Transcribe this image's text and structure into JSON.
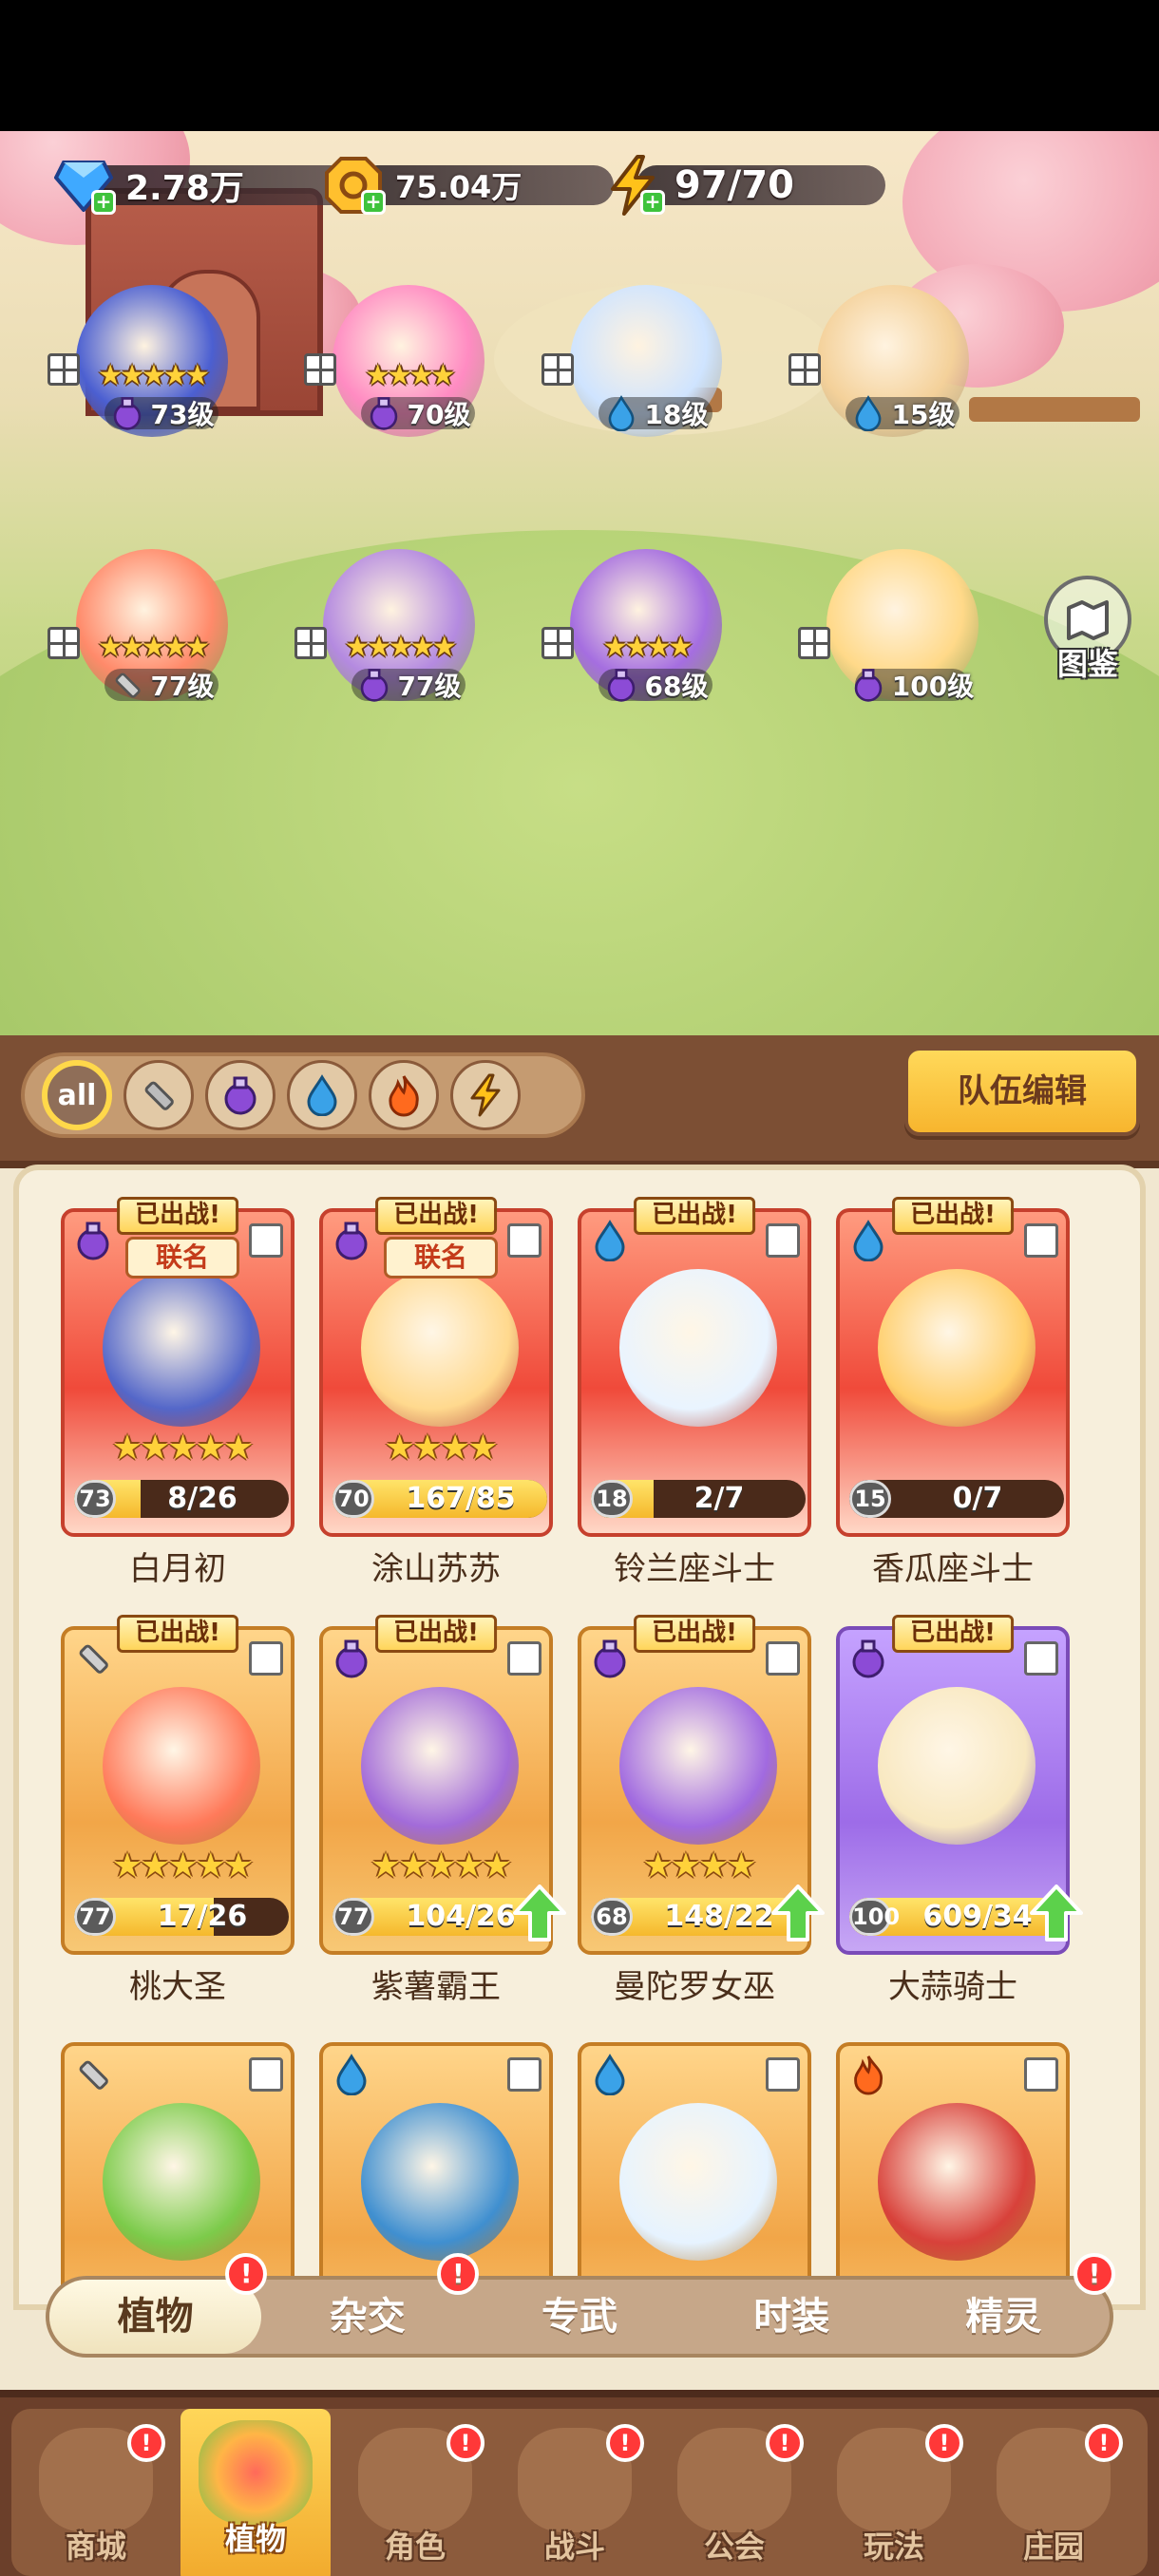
{
  "currency": {
    "gems": "2.78万",
    "coins": "75.04万",
    "energy": "97/70"
  },
  "atlas": {
    "label": "图鉴"
  },
  "field": [
    {
      "stars": "★★★★★",
      "level": "73级",
      "element": "potion"
    },
    {
      "stars": "★★★★",
      "level": "70级",
      "element": "potion"
    },
    {
      "stars": "",
      "level": "18级",
      "element": "water"
    },
    {
      "stars": "",
      "level": "15级",
      "element": "water"
    },
    {
      "stars": "★★★★★",
      "level": "77级",
      "element": "sword"
    },
    {
      "stars": "★★★★★",
      "level": "77级",
      "element": "potion"
    },
    {
      "stars": "★★★★",
      "level": "68级",
      "element": "potion"
    },
    {
      "stars": "",
      "level": "100级",
      "element": "potion"
    }
  ],
  "filters": {
    "all_label": "all",
    "items": [
      "all",
      "sword",
      "potion",
      "water",
      "fire",
      "lightning"
    ]
  },
  "team_edit": "队伍编辑",
  "deployed_label": "已出战!",
  "cards": [
    {
      "name": "白月初",
      "tag": "联名",
      "stars": "★★★★★",
      "level": "73",
      "fragments": "8/26",
      "progress": 0.31,
      "rarity": "red",
      "element": "potion",
      "upgradable": false
    },
    {
      "name": "涂山苏苏",
      "tag": "联名",
      "stars": "★★★★",
      "level": "70",
      "fragments": "167/85",
      "progress": 1.0,
      "rarity": "red",
      "element": "potion",
      "upgradable": false
    },
    {
      "name": "铃兰座斗士",
      "tag": "",
      "stars": "",
      "level": "18",
      "fragments": "2/7",
      "progress": 0.29,
      "rarity": "red",
      "element": "water",
      "upgradable": false
    },
    {
      "name": "香瓜座斗士",
      "tag": "",
      "stars": "",
      "level": "15",
      "fragments": "0/7",
      "progress": 0.0,
      "rarity": "red",
      "element": "water",
      "upgradable": false
    },
    {
      "name": "桃大圣",
      "tag": "",
      "stars": "★★★★★",
      "level": "77",
      "fragments": "17/26",
      "progress": 0.65,
      "rarity": "gold",
      "element": "sword",
      "upgradable": false
    },
    {
      "name": "紫薯霸王",
      "tag": "",
      "stars": "★★★★★",
      "level": "77",
      "fragments": "104/26",
      "progress": 1.0,
      "rarity": "gold",
      "element": "potion",
      "upgradable": true
    },
    {
      "name": "曼陀罗女巫",
      "tag": "",
      "stars": "★★★★",
      "level": "68",
      "fragments": "148/22",
      "progress": 1.0,
      "rarity": "gold",
      "element": "potion",
      "upgradable": true
    },
    {
      "name": "大蒜骑士",
      "tag": "",
      "stars": "",
      "level": "100",
      "fragments": "609/34",
      "progress": 1.0,
      "rarity": "purple",
      "element": "potion",
      "upgradable": true
    }
  ],
  "partial_cards": [
    {
      "element": "sword"
    },
    {
      "element": "water"
    },
    {
      "element": "water"
    },
    {
      "element": "fire"
    }
  ],
  "sub_tabs": [
    {
      "label": "植物",
      "active": true,
      "alert": true
    },
    {
      "label": "杂交",
      "active": false,
      "alert": true
    },
    {
      "label": "专武",
      "active": false,
      "alert": false
    },
    {
      "label": "时装",
      "active": false,
      "alert": false
    },
    {
      "label": "精灵",
      "active": false,
      "alert": true
    }
  ],
  "alert_mark": "!",
  "bottom_nav": [
    {
      "label": "商城",
      "active": false,
      "alert": true
    },
    {
      "label": "植物",
      "active": true,
      "alert": false
    },
    {
      "label": "角色",
      "active": false,
      "alert": true
    },
    {
      "label": "战斗",
      "active": false,
      "alert": true
    },
    {
      "label": "公会",
      "active": false,
      "alert": true
    },
    {
      "label": "玩法",
      "active": false,
      "alert": true
    },
    {
      "label": "庄园",
      "active": false,
      "alert": true
    }
  ],
  "colors": {
    "potion": "#8c4bd6",
    "water": "#3aa2e8",
    "sword": "#9a9a9a",
    "fire": "#ff6a1e",
    "lightning": "#ffc21a",
    "deployed_badge": "#ffd55a",
    "alert": "#ff3838"
  }
}
